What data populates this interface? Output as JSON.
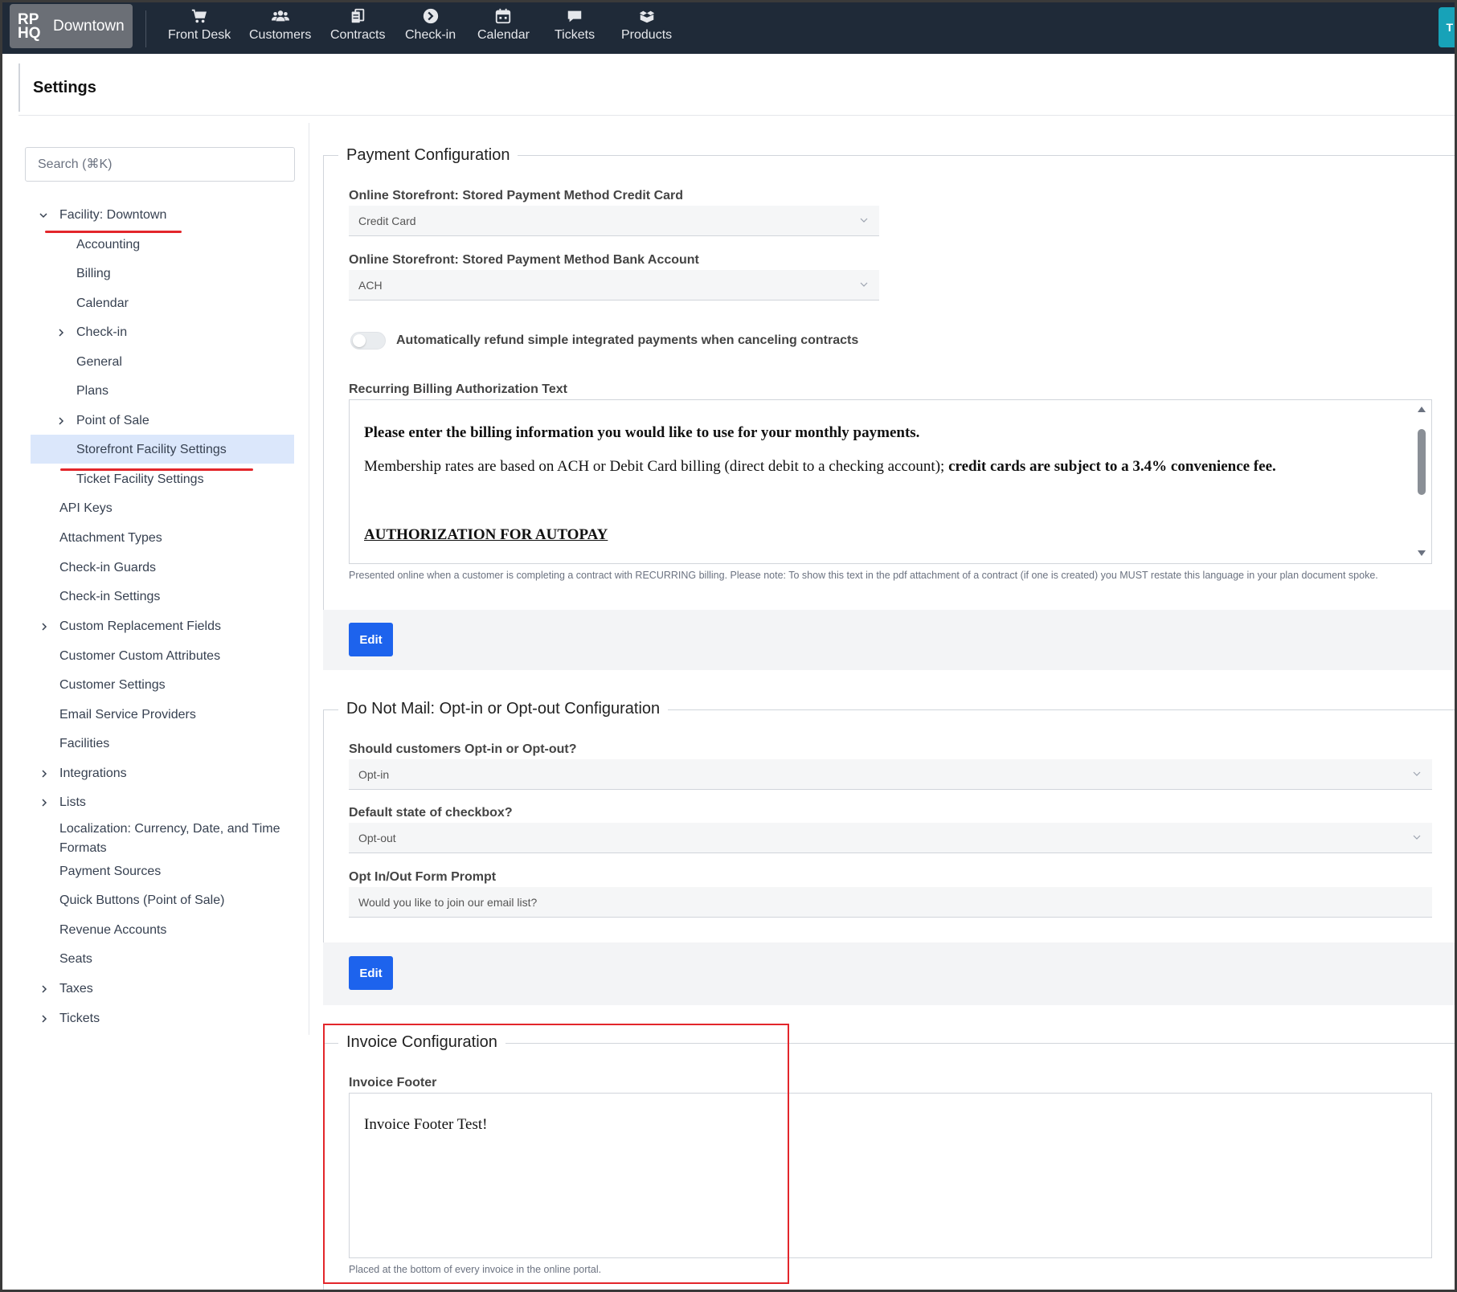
{
  "nav": {
    "brand_logo": "RP HQ",
    "brand_name": "Downtown",
    "items": [
      {
        "label": "Front Desk",
        "icon": "cart-icon"
      },
      {
        "label": "Customers",
        "icon": "users-icon"
      },
      {
        "label": "Contracts",
        "icon": "contracts-icon"
      },
      {
        "label": "Check-in",
        "icon": "arrow-circle-right-icon"
      },
      {
        "label": "Calendar",
        "icon": "calendar-icon"
      },
      {
        "label": "Tickets",
        "icon": "comment-icon"
      },
      {
        "label": "Products",
        "icon": "boxes-icon"
      }
    ],
    "right_tab": "T"
  },
  "header": {
    "title": "Settings"
  },
  "sidebar": {
    "search_placeholder": "Search (⌘K)",
    "items": [
      {
        "label": "Facility: Downtown",
        "expanded": true
      },
      {
        "label": "Accounting"
      },
      {
        "label": "Billing"
      },
      {
        "label": "Calendar"
      },
      {
        "label": "Check-in",
        "collapsed": true
      },
      {
        "label": "General"
      },
      {
        "label": "Plans"
      },
      {
        "label": "Point of Sale",
        "collapsed": true
      },
      {
        "label": "Storefront Facility Settings",
        "selected": true
      },
      {
        "label": "Ticket Facility Settings"
      },
      {
        "label": "API Keys"
      },
      {
        "label": "Attachment Types"
      },
      {
        "label": "Check-in Guards"
      },
      {
        "label": "Check-in Settings"
      },
      {
        "label": "Custom Replacement Fields",
        "collapsed": true
      },
      {
        "label": "Customer Custom Attributes"
      },
      {
        "label": "Customer Settings"
      },
      {
        "label": "Email Service Providers"
      },
      {
        "label": "Facilities"
      },
      {
        "label": "Integrations",
        "collapsed": true
      },
      {
        "label": "Lists",
        "collapsed": true
      },
      {
        "label": "Localization: Currency, Date, and Time Formats"
      },
      {
        "label": "Payment Sources"
      },
      {
        "label": "Quick Buttons (Point of Sale)"
      },
      {
        "label": "Revenue Accounts"
      },
      {
        "label": "Seats"
      },
      {
        "label": "Taxes",
        "collapsed": true
      },
      {
        "label": "Tickets",
        "collapsed": true
      }
    ]
  },
  "payment": {
    "legend": "Payment Configuration",
    "cc_label": "Online Storefront: Stored Payment Method Credit Card",
    "cc_value": "Credit Card",
    "bank_label": "Online Storefront: Stored Payment Method Bank Account",
    "bank_value": "ACH",
    "refund_toggle_label": "Automatically refund simple integrated payments when canceling contracts",
    "refund_toggle_on": false,
    "recurring_label": "Recurring Billing Authorization Text",
    "recurring_line1": "Please enter the billing information you would like to use for your monthly payments.",
    "recurring_line2_normal": "Membership rates are based on ACH or Debit Card billing (direct debit to a checking account); ",
    "recurring_line2_bold": "credit cards are subject to a 3.4% convenience fee.",
    "recurring_heading": "AUTHORIZATION FOR AUTOPAY",
    "recurring_help": "Presented online when a customer is completing a contract with RECURRING billing. Please note: To show this text in the pdf attachment of a contract (if one is created) you MUST restate this language in your plan document spoke.",
    "edit_label": "Edit"
  },
  "donotmail": {
    "legend": "Do Not Mail: Opt-in or Opt-out Configuration",
    "optin_label": "Should customers Opt-in or Opt-out?",
    "optin_value": "Opt-in",
    "default_label": "Default state of checkbox?",
    "default_value": "Opt-out",
    "prompt_label": "Opt In/Out Form Prompt",
    "prompt_value": "Would you like to join our email list?",
    "edit_label": "Edit"
  },
  "invoice": {
    "legend": "Invoice Configuration",
    "footer_label": "Invoice Footer",
    "footer_text": "Invoice Footer Test!",
    "footer_help": "Placed at the bottom of every invoice in the online portal."
  },
  "colors": {
    "nav_bg": "#1f2a38",
    "accent": "#1d63ed",
    "annotation": "#e3262b",
    "selected": "#dbe7fb"
  }
}
